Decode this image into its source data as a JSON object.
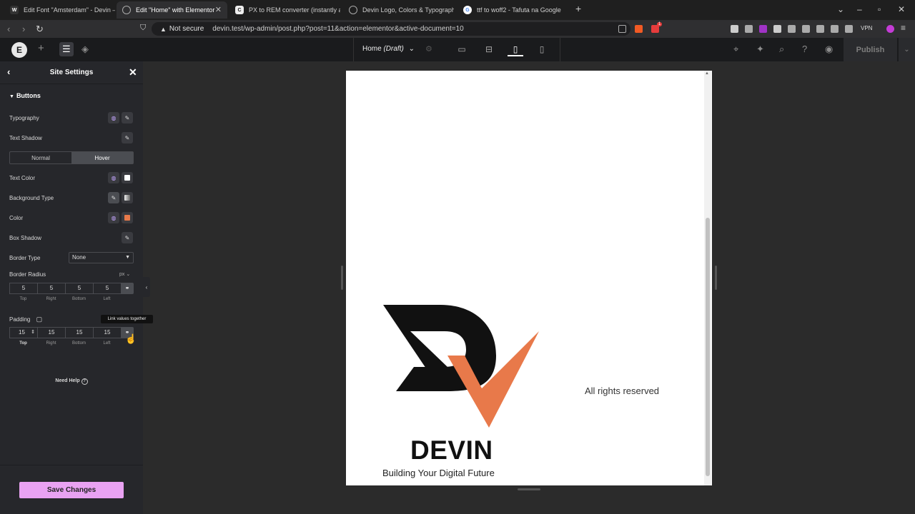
{
  "browser": {
    "tabs": [
      {
        "label": "Edit Font \"Amsterdam\" - Devin — W",
        "icon": "wordpress-icon",
        "active": false
      },
      {
        "label": "Edit \"Home\" with Elementor",
        "icon": "globe-icon",
        "active": true
      },
      {
        "label": "PX to REM converter (instantly and",
        "icon": "c-logo-icon",
        "active": false
      },
      {
        "label": "Devin Logo, Colors & Typography",
        "icon": "globe-icon",
        "active": false
      },
      {
        "label": "ttf to woff2 - Tafuta na Google",
        "icon": "google-icon",
        "active": false
      }
    ],
    "security": "Not secure",
    "url": "devin.test/wp-admin/post.php?post=11&action=elementor&active-document=10",
    "vpn_label": "VPN",
    "badge": "1"
  },
  "topbar": {
    "page_title": "Home",
    "page_status": "(Draft)",
    "publish_label": "Publish"
  },
  "panel": {
    "title": "Site Settings",
    "section": "Buttons",
    "typography_label": "Typography",
    "text_shadow_label": "Text Shadow",
    "tab_normal": "Normal",
    "tab_hover": "Hover",
    "text_color_label": "Text Color",
    "bg_type_label": "Background Type",
    "color_label": "Color",
    "box_shadow_label": "Box Shadow",
    "border_type_label": "Border Type",
    "border_type_value": "None",
    "border_radius_label": "Border Radius",
    "unit": "px",
    "radius": {
      "top": "5",
      "right": "5",
      "bottom": "5",
      "left": "5"
    },
    "padding_label": "Padding",
    "padding": {
      "top": "15",
      "right": "15",
      "bottom": "15",
      "left": "15"
    },
    "dim_labels": {
      "top": "Top",
      "right": "Right",
      "bottom": "Bottom",
      "left": "Left"
    },
    "tooltip": "Link values together",
    "help": "Need Help",
    "save_label": "Save Changes"
  },
  "canvas": {
    "brand_name": "DEVIN",
    "tagline": "Building Your Digital Future",
    "rights": "All rights reserved"
  },
  "colors": {
    "accent": "#e9a2f2",
    "brand_orange": "#e8794a",
    "text_color_swatch": "#ffffff",
    "color_swatch": "#e8794a"
  }
}
